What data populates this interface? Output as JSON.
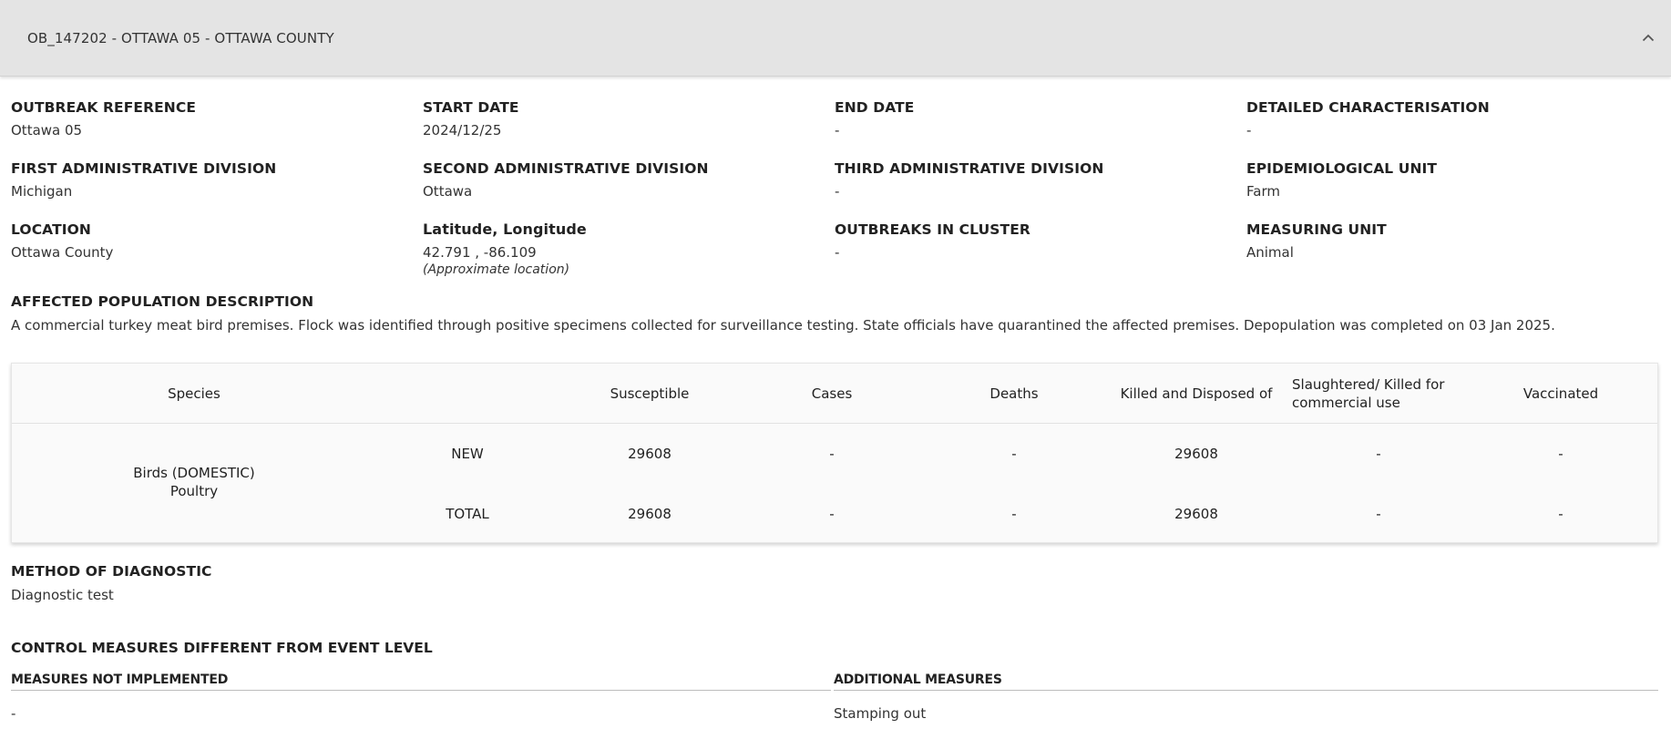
{
  "header": {
    "title": "OB_147202 - OTTAWA 05 - OTTAWA COUNTY",
    "toggle_icon": "chevron-up-icon"
  },
  "fields": {
    "outbreak_reference": {
      "label": "OUTBREAK REFERENCE",
      "value": "Ottawa 05"
    },
    "start_date": {
      "label": "START DATE",
      "value": "2024/12/25"
    },
    "end_date": {
      "label": "END DATE",
      "value": "-"
    },
    "detailed_characterisation": {
      "label": "DETAILED CHARACTERISATION",
      "value": "-"
    },
    "first_admin": {
      "label": "FIRST ADMINISTRATIVE DIVISION",
      "value": "Michigan"
    },
    "second_admin": {
      "label": "SECOND ADMINISTRATIVE DIVISION",
      "value": "Ottawa"
    },
    "third_admin": {
      "label": "THIRD ADMINISTRATIVE DIVISION",
      "value": "-"
    },
    "epi_unit": {
      "label": "EPIDEMIOLOGICAL UNIT",
      "value": "Farm"
    },
    "location": {
      "label": "LOCATION",
      "value": "Ottawa County"
    },
    "lat_long": {
      "label": "Latitude, Longitude",
      "value": "42.791 , -86.109",
      "note": "(Approximate location)"
    },
    "outbreaks_in_cluster": {
      "label": "OUTBREAKS IN CLUSTER",
      "value": "-"
    },
    "measuring_unit": {
      "label": "MEASURING UNIT",
      "value": "Animal"
    }
  },
  "affected_population": {
    "label": "AFFECTED POPULATION DESCRIPTION",
    "value": "A commercial turkey meat bird premises. Flock was identified through positive specimens collected for surveillance testing. State officials have quarantined the affected premises. Depopulation was completed on 03 Jan 2025."
  },
  "table": {
    "headers": {
      "species": "Species",
      "susceptible": "Susceptible",
      "cases": "Cases",
      "deaths": "Deaths",
      "killed": "Killed and Disposed of",
      "slaughtered": "Slaughtered/ Killed for commercial use",
      "vaccinated": "Vaccinated"
    },
    "species_line1": "Birds (DOMESTIC)",
    "species_line2": "Poultry",
    "rows": [
      {
        "type": "NEW",
        "susceptible": "29608",
        "cases": "-",
        "deaths": "-",
        "killed": "29608",
        "slaughtered": "-",
        "vaccinated": "-"
      },
      {
        "type": "TOTAL",
        "susceptible": "29608",
        "cases": "-",
        "deaths": "-",
        "killed": "29608",
        "slaughtered": "-",
        "vaccinated": "-"
      }
    ]
  },
  "method_of_diagnostic": {
    "label": "METHOD OF DIAGNOSTIC",
    "value": "Diagnostic test"
  },
  "control_measures": {
    "title": "CONTROL MEASURES DIFFERENT FROM EVENT LEVEL",
    "not_implemented_label": "MEASURES NOT IMPLEMENTED",
    "not_implemented_value": "-",
    "additional_label": "ADDITIONAL MEASURES",
    "additional_value": "Stamping out"
  }
}
